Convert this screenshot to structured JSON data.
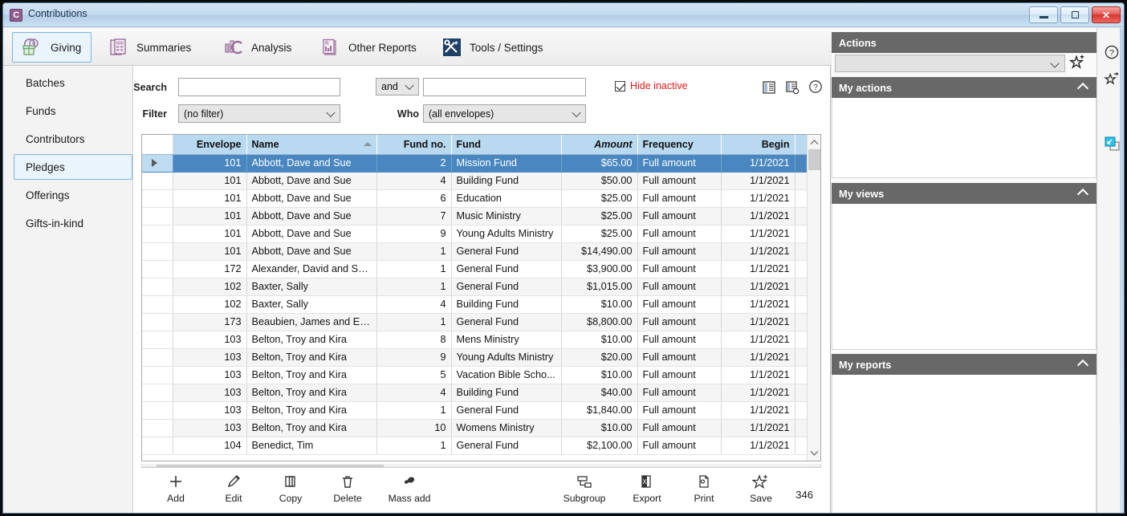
{
  "window": {
    "title": "Contributions",
    "icon": "contributions-app-icon",
    "minimize_label": "Minimize",
    "maximize_label": "Maximize",
    "close_label": "Close"
  },
  "tabs": [
    {
      "label": "Giving",
      "icon": "giving-icon",
      "active": true
    },
    {
      "label": "Summaries",
      "icon": "summaries-icon",
      "active": false
    },
    {
      "label": "Analysis",
      "icon": "analysis-icon",
      "active": false
    },
    {
      "label": "Other Reports",
      "icon": "other-reports-icon",
      "active": false
    },
    {
      "label": "Tools / Settings",
      "icon": "tools-settings-icon",
      "active": false
    }
  ],
  "sidebar": {
    "items": [
      {
        "label": "Batches",
        "active": false
      },
      {
        "label": "Funds",
        "active": false
      },
      {
        "label": "Contributors",
        "active": false
      },
      {
        "label": "Pledges",
        "active": true
      },
      {
        "label": "Offerings",
        "active": false
      },
      {
        "label": "Gifts-in-kind",
        "active": false
      }
    ]
  },
  "search": {
    "search_label": "Search",
    "search_value": "",
    "operator_value": "and",
    "second_value": "",
    "filter_label": "Filter",
    "filter_value": "(no filter)",
    "who_label": "Who",
    "who_value": "(all envelopes)",
    "hide_inactive_label": "Hide inactive",
    "hide_inactive_checked": true,
    "hide_inactive_color": "#e01b1b",
    "icons": [
      {
        "name": "columns-icon"
      },
      {
        "name": "layout-settings-icon"
      },
      {
        "name": "help-icon"
      }
    ]
  },
  "grid": {
    "columns": [
      {
        "label": "Envelope",
        "align": "right",
        "italic": false,
        "sorted": false
      },
      {
        "label": "Name",
        "align": "left",
        "italic": false,
        "sorted": true
      },
      {
        "label": "Fund no.",
        "align": "right",
        "italic": false,
        "sorted": false
      },
      {
        "label": "Fund",
        "align": "left",
        "italic": false,
        "sorted": false
      },
      {
        "label": "Amount",
        "align": "right",
        "italic": true,
        "sorted": false
      },
      {
        "label": "Frequency",
        "align": "left",
        "italic": false,
        "sorted": false
      },
      {
        "label": "Begin",
        "align": "right",
        "italic": false,
        "sorted": false
      }
    ],
    "rows": [
      {
        "envelope": "101",
        "name": "Abbott, Dave and Sue",
        "fund_no": "2",
        "fund": "Mission Fund",
        "amount": "$65.00",
        "frequency": "Full amount",
        "begin": "1/1/2021",
        "selected": true
      },
      {
        "envelope": "101",
        "name": "Abbott, Dave and Sue",
        "fund_no": "4",
        "fund": "Building Fund",
        "amount": "$50.00",
        "frequency": "Full amount",
        "begin": "1/1/2021",
        "selected": false
      },
      {
        "envelope": "101",
        "name": "Abbott, Dave and Sue",
        "fund_no": "6",
        "fund": "Education",
        "amount": "$25.00",
        "frequency": "Full amount",
        "begin": "1/1/2021",
        "selected": false
      },
      {
        "envelope": "101",
        "name": "Abbott, Dave and Sue",
        "fund_no": "7",
        "fund": "Music Ministry",
        "amount": "$25.00",
        "frequency": "Full amount",
        "begin": "1/1/2021",
        "selected": false
      },
      {
        "envelope": "101",
        "name": "Abbott, Dave and Sue",
        "fund_no": "9",
        "fund": "Young Adults Ministry",
        "amount": "$25.00",
        "frequency": "Full amount",
        "begin": "1/1/2021",
        "selected": false
      },
      {
        "envelope": "101",
        "name": "Abbott, Dave and Sue",
        "fund_no": "1",
        "fund": "General Fund",
        "amount": "$14,490.00",
        "frequency": "Full amount",
        "begin": "1/1/2021",
        "selected": false
      },
      {
        "envelope": "172",
        "name": "Alexander, David and Sh...",
        "fund_no": "1",
        "fund": "General Fund",
        "amount": "$3,900.00",
        "frequency": "Full amount",
        "begin": "1/1/2021",
        "selected": false
      },
      {
        "envelope": "102",
        "name": "Baxter, Sally",
        "fund_no": "1",
        "fund": "General Fund",
        "amount": "$1,015.00",
        "frequency": "Full amount",
        "begin": "1/1/2021",
        "selected": false
      },
      {
        "envelope": "102",
        "name": "Baxter, Sally",
        "fund_no": "4",
        "fund": "Building Fund",
        "amount": "$10.00",
        "frequency": "Full amount",
        "begin": "1/1/2021",
        "selected": false
      },
      {
        "envelope": "173",
        "name": "Beaubien, James and Ell...",
        "fund_no": "1",
        "fund": "General Fund",
        "amount": "$8,800.00",
        "frequency": "Full amount",
        "begin": "1/1/2021",
        "selected": false
      },
      {
        "envelope": "103",
        "name": "Belton, Troy and Kira",
        "fund_no": "8",
        "fund": "Mens Ministry",
        "amount": "$10.00",
        "frequency": "Full amount",
        "begin": "1/1/2021",
        "selected": false
      },
      {
        "envelope": "103",
        "name": "Belton, Troy and Kira",
        "fund_no": "9",
        "fund": "Young Adults Ministry",
        "amount": "$20.00",
        "frequency": "Full amount",
        "begin": "1/1/2021",
        "selected": false
      },
      {
        "envelope": "103",
        "name": "Belton, Troy and Kira",
        "fund_no": "5",
        "fund": "Vacation Bible Scho...",
        "amount": "$10.00",
        "frequency": "Full amount",
        "begin": "1/1/2021",
        "selected": false
      },
      {
        "envelope": "103",
        "name": "Belton, Troy and Kira",
        "fund_no": "4",
        "fund": "Building Fund",
        "amount": "$40.00",
        "frequency": "Full amount",
        "begin": "1/1/2021",
        "selected": false
      },
      {
        "envelope": "103",
        "name": "Belton, Troy and Kira",
        "fund_no": "1",
        "fund": "General Fund",
        "amount": "$1,840.00",
        "frequency": "Full amount",
        "begin": "1/1/2021",
        "selected": false
      },
      {
        "envelope": "103",
        "name": "Belton, Troy and Kira",
        "fund_no": "10",
        "fund": "Womens Ministry",
        "amount": "$10.00",
        "frequency": "Full amount",
        "begin": "1/1/2021",
        "selected": false
      },
      {
        "envelope": "104",
        "name": "Benedict, Tim",
        "fund_no": "1",
        "fund": "General Fund",
        "amount": "$2,100.00",
        "frequency": "Full amount",
        "begin": "1/1/2021",
        "selected": false
      }
    ]
  },
  "bottom_toolbar": {
    "buttons": [
      {
        "label": "Add",
        "icon": "plus-icon"
      },
      {
        "label": "Edit",
        "icon": "pencil-icon"
      },
      {
        "label": "Copy",
        "icon": "copy-icon"
      },
      {
        "label": "Delete",
        "icon": "trash-icon"
      },
      {
        "label": "Mass add",
        "icon": "mass-add-icon"
      },
      {
        "label": "Subgroup",
        "icon": "subgroup-icon"
      },
      {
        "label": "Export",
        "icon": "excel-export-icon"
      },
      {
        "label": "Print",
        "icon": "print-icon"
      },
      {
        "label": "Save",
        "icon": "star-save-icon"
      }
    ],
    "record_count": "346"
  },
  "right_panel": {
    "actions_title": "Actions",
    "action_select_value": "",
    "add-favorite-icon": "star-plus-icon",
    "sections": [
      {
        "title": "My actions",
        "items": []
      },
      {
        "title": "My views",
        "items": []
      },
      {
        "title": "My reports",
        "items": []
      }
    ]
  },
  "right_strip": {
    "icons": [
      {
        "name": "help-circle-icon"
      },
      {
        "name": "star-shortcut-icon"
      },
      {
        "name": "restore-window-icon"
      }
    ]
  },
  "colors": {
    "header_blue": "#b8d9f0",
    "selection_blue": "#4a87c0",
    "panel_gray": "#686868",
    "alert_red": "#e01b1b",
    "accent_purple": "#8e5d8e"
  }
}
